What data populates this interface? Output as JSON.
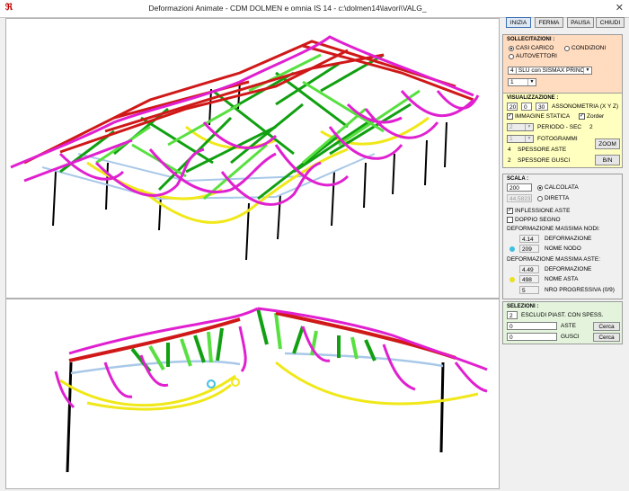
{
  "window": {
    "title": "Deformazioni Animate - CDM DOLMEN e omnia IS 14 - c:\\dolmen14\\lavori\\VALG_",
    "icon": "dolmen-logo-icon",
    "close_symbol": "✕"
  },
  "toolbar": {
    "inizia": "INIZIA",
    "ferma": "FERMA",
    "pausa": "PAUSA",
    "chiudi": "CHIUDI"
  },
  "sollecitazioni": {
    "title": "SOLLECITAZIONI :",
    "casi_carico": "CASI CARICO",
    "condizioni": "CONDIZIONI",
    "autovettori": "AUTOVETTORI",
    "selected": "CASI CARICO",
    "combo_value": "4 | SLU con SISMAX PRINC",
    "index_value": "1",
    "color": "#ffdcc0"
  },
  "visualizzazione": {
    "title": "VISUALIZZAZIONE :",
    "ax": "20",
    "ay": "0",
    "az": "30",
    "assonometria": "ASSONOMETRIA (X Y Z)",
    "immagine_statica": "IMMAGINE STATICA",
    "zorder": "Zorder",
    "periodo_value": "2",
    "periodo_label": "PERIODO - SEC",
    "periodo_sec": "2",
    "fotogrammi_value": "1",
    "fotogrammi_label": "FOTOGRAMMI",
    "spessore_aste_value": "4",
    "spessore_aste_label": "SPESSORE ASTE",
    "spessore_gusci_value": "2",
    "spessore_gusci_label": "SPESSORE GUSCI",
    "zoom": "ZOOM",
    "bn": "B/N",
    "color": "#ffffc0"
  },
  "scala": {
    "title": "SCALA :",
    "calcolata_value": "200",
    "calcolata": "CALCOLATA",
    "diretta_value": "44.5823",
    "diretta": "DIRETTA",
    "inflessione_aste": "INFLESSIONE ASTE",
    "doppio_segno": "DOPPIO SEGNO",
    "def_max_nodi": "DEFORMAZIONE MASSIMA NODI:",
    "nodo_def_value": "4.14",
    "deformazione": "DEFORMAZIONE",
    "nodo_value": "209",
    "nome_nodo": "NOME NODO",
    "def_max_aste": "DEFORMAZIONE MASSIMA ASTE:",
    "asta_def_value": "4.49",
    "asta_value": "498",
    "nome_asta": "NOME ASTA",
    "nro_value": "5",
    "nro_progressiva": "NRO PROGRESSIVA (0/9)",
    "node_marker_color": "#40c0e0",
    "asta_marker_color": "#e8e020"
  },
  "selezioni": {
    "title": "SELEZIONI :",
    "escludi_value": "2",
    "escludi_label": "ESCLUDI PIAST. CON SPESS.",
    "aste_value": "0",
    "aste_label": "ASTE",
    "gusci_value": "0",
    "gusci_label": "GUSCI",
    "cerca": "Cerca",
    "color": "#e4f4dc"
  },
  "colors": {
    "magenta": "#e020d0",
    "red": "#d01818",
    "green": "#10a010",
    "light_green": "#58e040",
    "yellow": "#f0e818",
    "light_blue": "#a8c8e8",
    "black": "#000000"
  }
}
